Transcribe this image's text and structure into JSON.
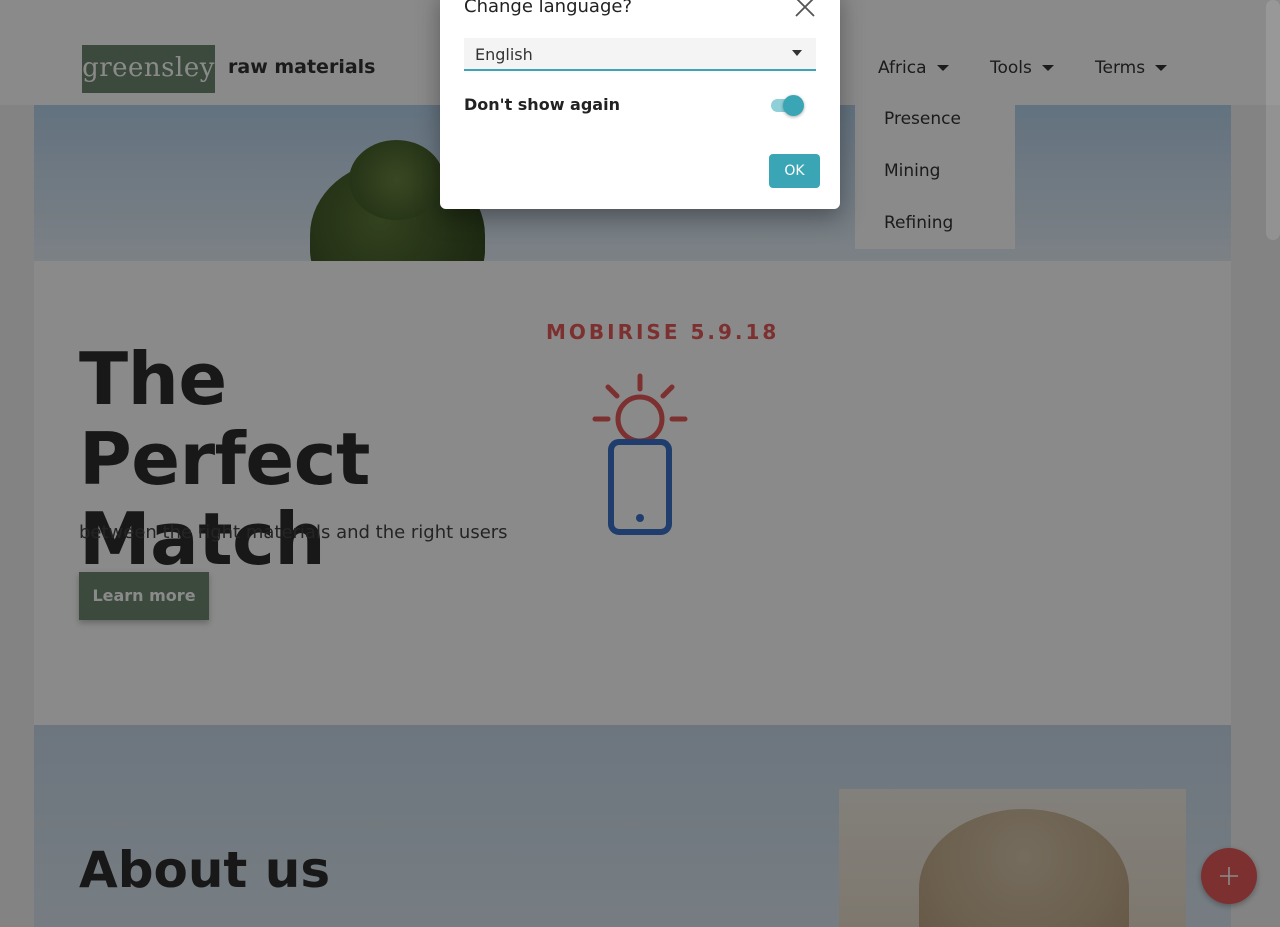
{
  "header": {
    "logo_text": "greensley",
    "brand_name": "raw materials",
    "nav": [
      {
        "label": "Africa"
      },
      {
        "label": "Tools"
      },
      {
        "label": "Terms"
      }
    ],
    "dropdown_items": [
      "Presence",
      "Mining",
      "Refining"
    ]
  },
  "hero": {
    "title": "The Perfect Match",
    "subtitle": "between the right materials and the right users",
    "button_label": "Learn more",
    "version_label": "MOBIRISE  5.9.18",
    "icon": "phone-idea-icon"
  },
  "about": {
    "title": "About us"
  },
  "modal": {
    "title": "Change language?",
    "selected_language": "English",
    "dont_show_label": "Don't show again",
    "dont_show_checked": true,
    "ok_label": "OK"
  },
  "colors": {
    "accent": "#3aa6b5",
    "brand_green": "#6d8a6f",
    "mobirise_red": "#e85a5a",
    "icon_blue": "#3b73c9"
  }
}
